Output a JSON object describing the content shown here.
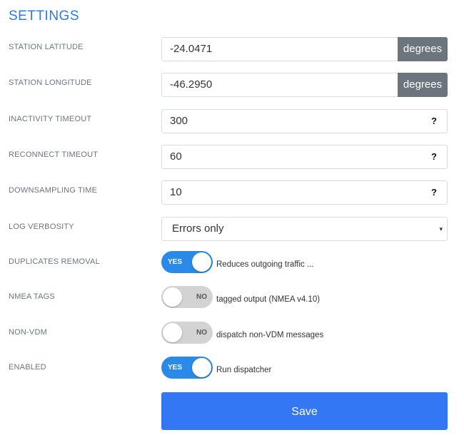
{
  "page": {
    "title": "SETTINGS"
  },
  "fields": {
    "latitude": {
      "label": "STATION LATITUDE",
      "value": "-24.0471",
      "unit": "degrees"
    },
    "longitude": {
      "label": "STATION LONGITUDE",
      "value": "-46.2950",
      "unit": "degrees"
    },
    "inactivity": {
      "label": "INACTIVITY TIMEOUT",
      "value": "300",
      "help": "?"
    },
    "reconnect": {
      "label": "RECONNECT TIMEOUT",
      "value": "60",
      "help": "?"
    },
    "downsampling": {
      "label": "DOWNSAMPLING TIME",
      "value": "10",
      "help": "?"
    },
    "log_verbosity": {
      "label": "LOG VERBOSITY",
      "value": "Errors only",
      "caret": "▾"
    }
  },
  "toggles": {
    "duplicates": {
      "label": "DUPLICATES REMOVAL",
      "state": "YES",
      "on": true,
      "description": "Reduces outgoing traffic ..."
    },
    "nmea_tags": {
      "label": "NMEA TAGS",
      "state": "NO",
      "on": false,
      "description": "tagged output (NMEA v4.10)"
    },
    "non_vdm": {
      "label": "NON-VDM",
      "state": "NO",
      "on": false,
      "description": "dispatch non-VDM messages"
    },
    "enabled": {
      "label": "ENABLED",
      "state": "YES",
      "on": true,
      "description": "Run dispatcher"
    }
  },
  "actions": {
    "save_label": "Save"
  },
  "colors": {
    "accent": "#2f7bd6",
    "toggle_on": "#2a8ae8",
    "toggle_off": "#d3d3d3",
    "addon": "#6c757d",
    "save_button": "#3477f5"
  },
  "icons": {
    "help": "question-mark-icon",
    "select_caret": "caret-down-icon"
  }
}
